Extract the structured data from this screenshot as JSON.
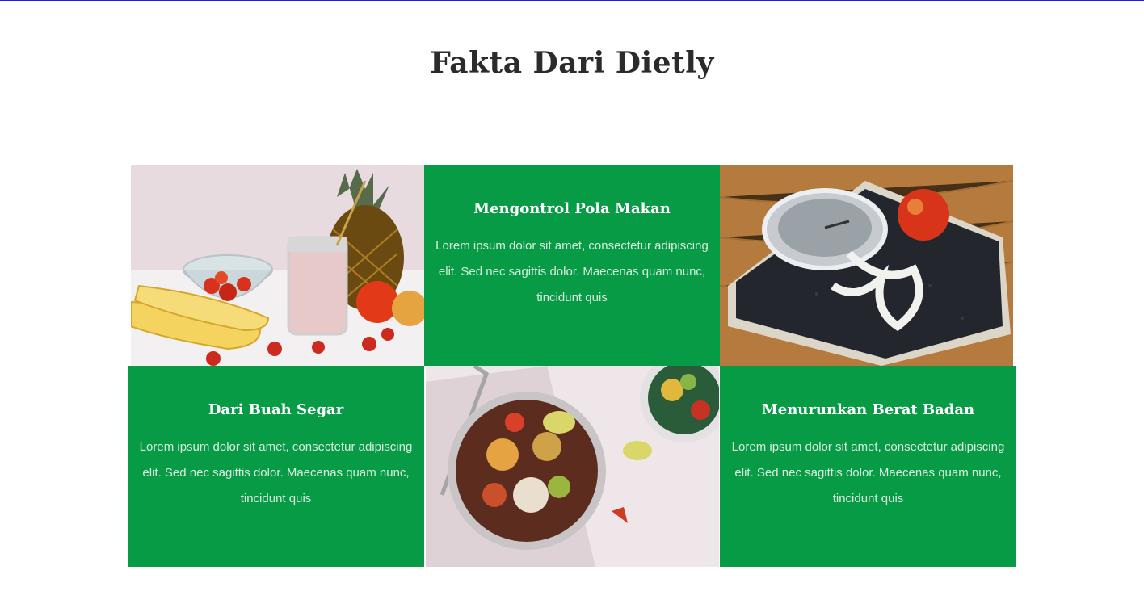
{
  "section": {
    "title": "Fakta Dari Dietly"
  },
  "cards": [
    {
      "title": "Mengontrol Pola Makan",
      "text": "Lorem ipsum dolor sit amet, consectetur adipiscing elit. Sed nec sagittis dolor. Maecenas quam nunc, tincidunt quis"
    },
    {
      "title": "Dari Buah Segar",
      "text": "Lorem ipsum dolor sit amet, consectetur adipiscing elit. Sed nec sagittis dolor. Maecenas quam nunc, tincidunt quis"
    },
    {
      "title": "Menurunkan Berat Badan",
      "text": "Lorem ipsum dolor sit amet, consectetur adipiscing elit. Sed nec sagittis dolor. Maecenas quam nunc, tincidunt quis"
    }
  ],
  "images": [
    {
      "name": "fruit-photo",
      "subject": "fruits-and-smoothie"
    },
    {
      "name": "scale-photo",
      "subject": "bathroom-scale-with-apple"
    },
    {
      "name": "salad-bowl-photo",
      "subject": "salad-bowl"
    }
  ],
  "colors": {
    "accent_green": "#079b45",
    "title_text": "#2b2b2b",
    "card_text": "#d9eede"
  }
}
